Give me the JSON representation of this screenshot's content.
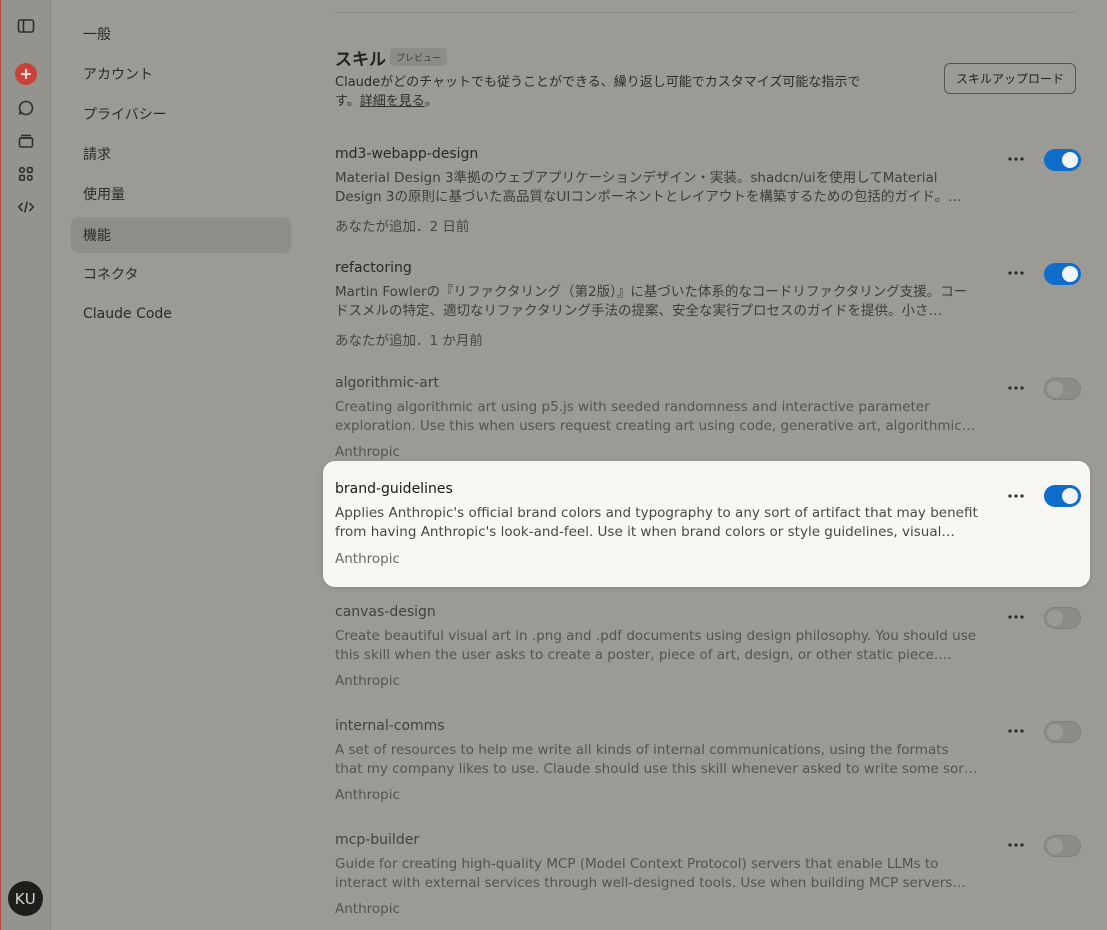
{
  "user": {
    "initials": "KU"
  },
  "nav": {
    "items": [
      {
        "label": "一般",
        "active": false
      },
      {
        "label": "アカウント",
        "active": false
      },
      {
        "label": "プライバシー",
        "active": false
      },
      {
        "label": "請求",
        "active": false
      },
      {
        "label": "使用量",
        "active": false
      },
      {
        "label": "機能",
        "active": true
      },
      {
        "label": "コネクタ",
        "active": false
      },
      {
        "label": "Claude Code",
        "active": false
      }
    ]
  },
  "skills_section": {
    "title": "スキル",
    "badge": "プレビュー",
    "description": "Claudeがどのチャットでも従うことができる、繰り返し可能でカスタマイズ可能な指示で",
    "description_line2": "す。",
    "learn_more": "詳細を見る",
    "description_end": "。",
    "upload_button": "スキルアップロード"
  },
  "skills": [
    {
      "name": "md3-webapp-design",
      "description": "Material Design 3準拠のウェブアプリケーションデザイン・実装。shadcn/uiを使用してMaterial Design 3の原則に基づいた高品質なUIコンポーネントとレイアウトを構築するための包括的ガイド。…",
      "meta": "あなたが追加．2 日前",
      "enabled": true
    },
    {
      "name": "refactoring",
      "description": "Martin Fowlerの『リファクタリング（第2版）』に基づいた体系的なコードリファクタリング支援。コードスメルの特定、適切なリファクタリング手法の提案、安全な実行プロセスのガイドを提供。小さ…",
      "meta": "あなたが追加．1 か月前",
      "enabled": true
    },
    {
      "name": "algorithmic-art",
      "description": "Creating algorithmic art using p5.js with seeded randomness and interactive parameter exploration. Use this when users request creating art using code, generative art, algorithmic art,…",
      "meta": "Anthropic",
      "enabled": false
    },
    {
      "name": "brand-guidelines",
      "description": "Applies Anthropic's official brand colors and typography to any sort of artifact that may benefit from having Anthropic's look-and-feel. Use it when brand colors or style guidelines, visual…",
      "meta": "Anthropic",
      "enabled": true,
      "highlighted": true
    },
    {
      "name": "canvas-design",
      "description": "Create beautiful visual art in .png and .pdf documents using design philosophy. You should use this skill when the user asks to create a poster, piece of art, design, or other static piece. Create…",
      "meta": "Anthropic",
      "enabled": false
    },
    {
      "name": "internal-comms",
      "description": "A set of resources to help me write all kinds of internal communications, using the formats that my company likes to use. Claude should use this skill whenever asked to write some sort of internal…",
      "meta": "Anthropic",
      "enabled": false
    },
    {
      "name": "mcp-builder",
      "description": "Guide for creating high-quality MCP (Model Context Protocol) servers that enable LLMs to interact with external services through well-designed tools. Use when building MCP servers to…",
      "meta": "Anthropic",
      "enabled": false
    }
  ],
  "icons": {
    "rail": [
      "sidebar-toggle-icon",
      "new-chat-icon",
      "chats-icon",
      "projects-icon",
      "artifacts-icon",
      "code-icon"
    ],
    "skill_more": "more-horizontal-icon"
  },
  "colors": {
    "toggle_on": "#0f6dcb",
    "new_chat": "#c8443a",
    "highlight_card": "#f8f7f4"
  }
}
